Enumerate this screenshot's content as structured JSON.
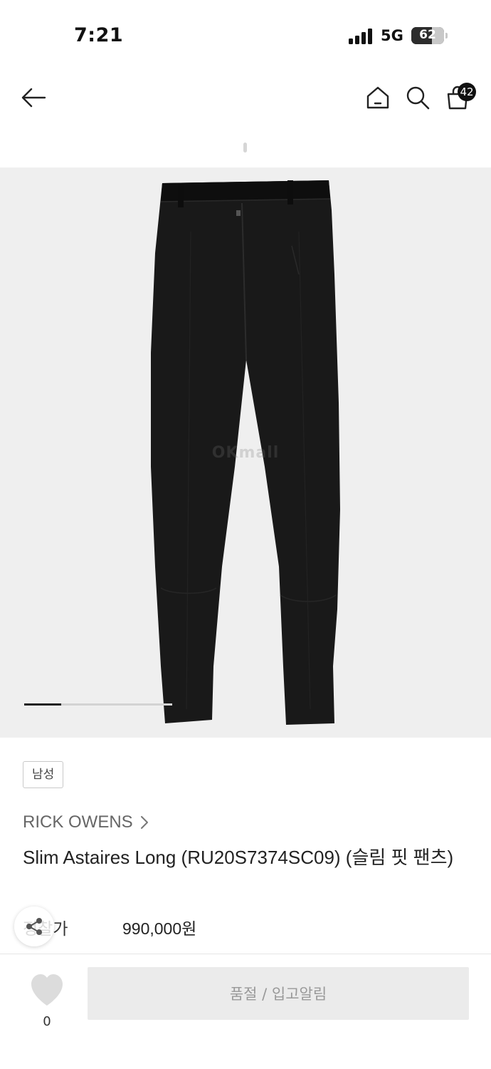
{
  "status_bar": {
    "time": "7:21",
    "network": "5G",
    "battery": "62",
    "battery_level_percent": 62
  },
  "header": {
    "back_icon": "arrow-left-icon",
    "home_icon": "home-icon",
    "search_icon": "search-icon",
    "cart_icon": "shopping-bag-icon",
    "cart_count": "42"
  },
  "gallery": {
    "watermark": "OKmall",
    "progress_fraction": 0.25
  },
  "product": {
    "gender_tag": "남성",
    "brand": "RICK OWENS",
    "name": "Slim Astaires Long (RU20S7374SC09) (슬림 핏 팬츠)",
    "price_label": "정찰가",
    "price_value": "990,000원"
  },
  "bottom_bar": {
    "wish_count": "0",
    "restock_label": "품절 / 입고알림"
  },
  "colors": {
    "accent": "#111111",
    "gallery_bg": "#efefef",
    "disabled_button": "#ebebeb"
  }
}
